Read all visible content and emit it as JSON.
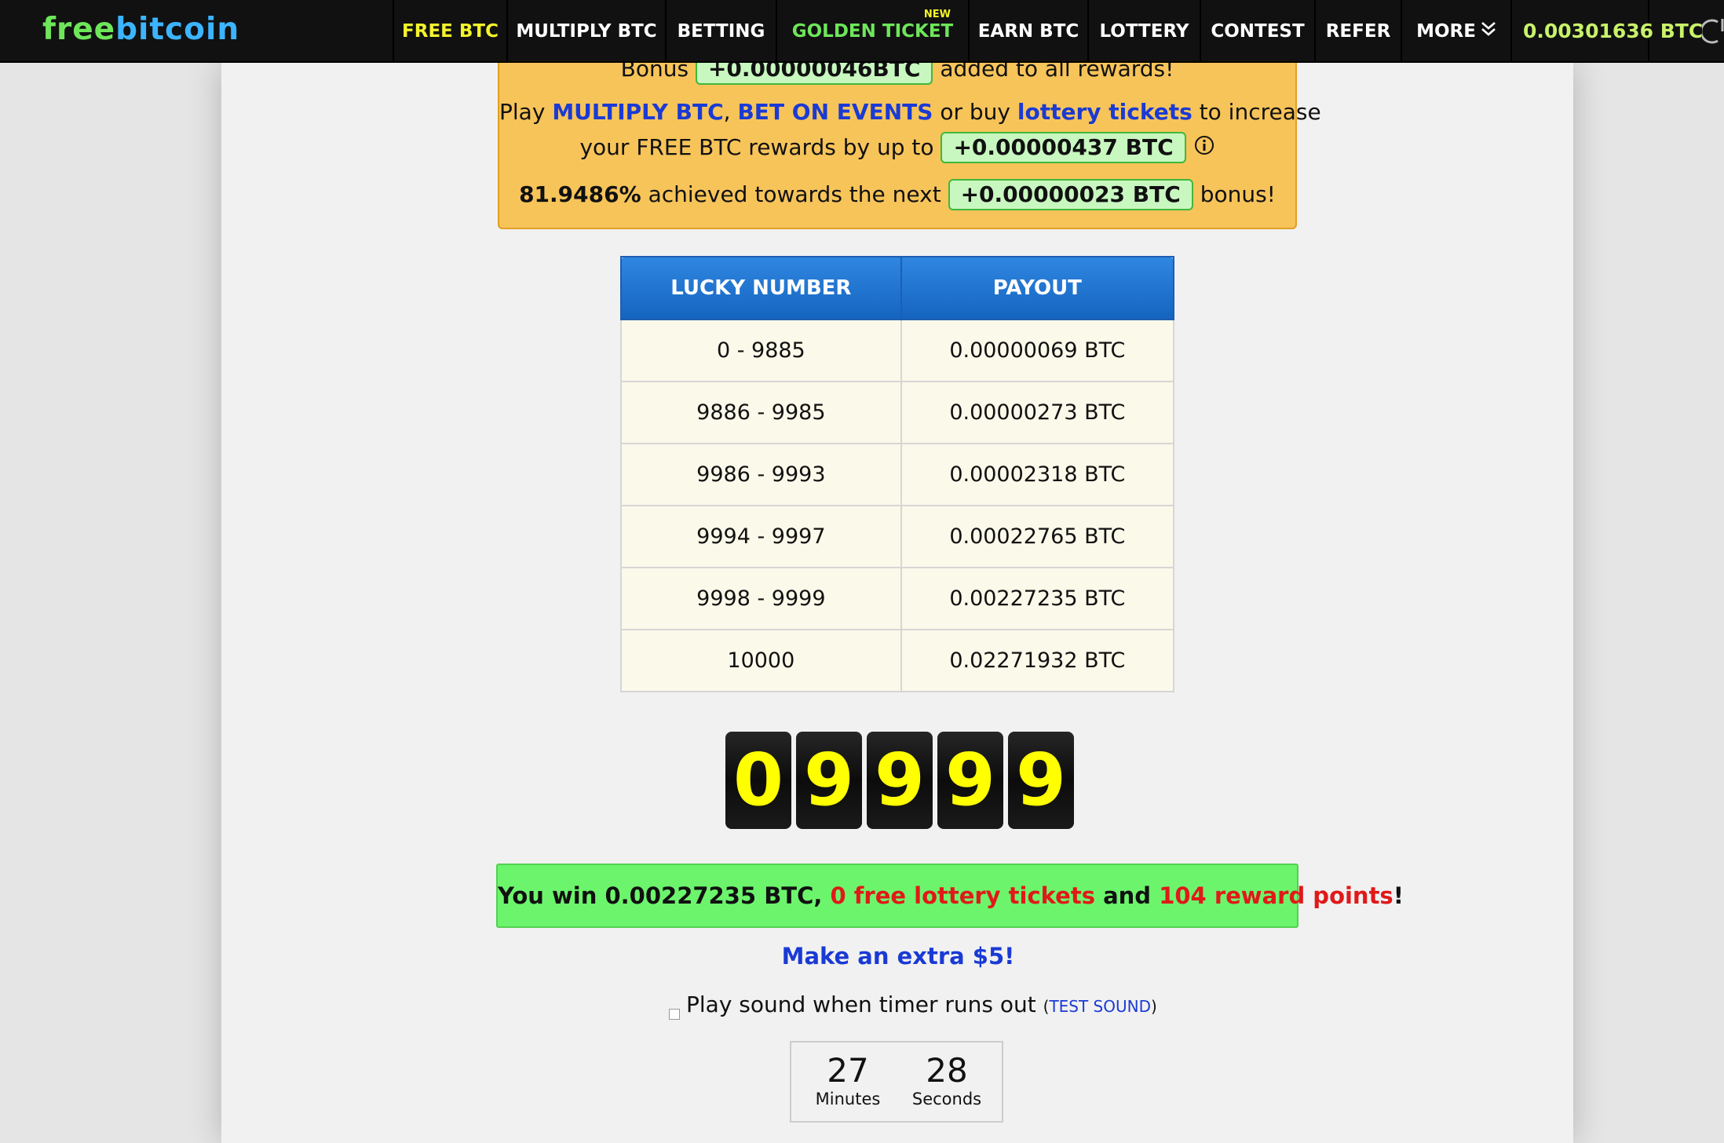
{
  "header": {
    "logo_part1": "free",
    "logo_part2": "bitcoin",
    "nav": [
      {
        "label": "FREE BTC"
      },
      {
        "label": "MULTIPLY BTC"
      },
      {
        "label": "BETTING"
      },
      {
        "label": "GOLDEN TICKET",
        "badge": "NEW"
      },
      {
        "label": "EARN BTC"
      },
      {
        "label": "LOTTERY"
      },
      {
        "label": "CONTEST"
      },
      {
        "label": "REFER"
      },
      {
        "label": "MORE"
      }
    ],
    "balance": "0.00301636 BTC"
  },
  "bonus": {
    "line1_prefix": "Bonus",
    "line1_amount": "+0.00000046BTC",
    "line1_suffix": "added to all rewards!",
    "line2_play": "Play",
    "line2_link1": "MULTIPLY BTC",
    "line2_comma": ",",
    "line2_link2": "BET ON EVENTS",
    "line2_or": "or buy",
    "line2_link3": "lottery tickets",
    "line2_suffix": "to increase",
    "line3_prefix": "your FREE BTC rewards by up to",
    "line3_amount": "+0.00000437 BTC",
    "line4_percent": "81.9486%",
    "line4_mid": "achieved towards the next",
    "line4_amount": "+0.00000023 BTC",
    "line4_suffix": "bonus!"
  },
  "payout_table": {
    "headers": [
      "LUCKY NUMBER",
      "PAYOUT"
    ],
    "rows": [
      [
        "0 - 9885",
        "0.00000069 BTC"
      ],
      [
        "9886 - 9985",
        "0.00000273 BTC"
      ],
      [
        "9986 - 9993",
        "0.00002318 BTC"
      ],
      [
        "9994 - 9997",
        "0.00022765 BTC"
      ],
      [
        "9998 - 9999",
        "0.00227235 BTC"
      ],
      [
        "10000",
        "0.02271932 BTC"
      ]
    ]
  },
  "lucky_digits": [
    "0",
    "9",
    "9",
    "9",
    "9"
  ],
  "win": {
    "prefix": "You win 0.00227235 BTC,",
    "tickets": "0 free lottery tickets",
    "and": "and",
    "points": "104 reward points",
    "bang": "!"
  },
  "extra_link": "Make an extra $5!",
  "sound": {
    "label": "Play sound when timer runs out",
    "open_paren": "(",
    "test": "TEST SOUND",
    "close_paren": ")"
  },
  "timer": {
    "minutes": "27",
    "minutes_label": "Minutes",
    "seconds": "28",
    "seconds_label": "Seconds"
  },
  "colors": {
    "nav_bg": "#111111",
    "active_nav": "#f4f42a",
    "golden_ticket": "#6ee65a",
    "balance": "#c8f26a",
    "bonus_bg": "#f7c45a",
    "table_header": "#1565c0",
    "win_bg": "#6cf56c",
    "link_blue": "#1a3ad4",
    "red_text": "#e01919",
    "digit_color": "#ffff00"
  }
}
